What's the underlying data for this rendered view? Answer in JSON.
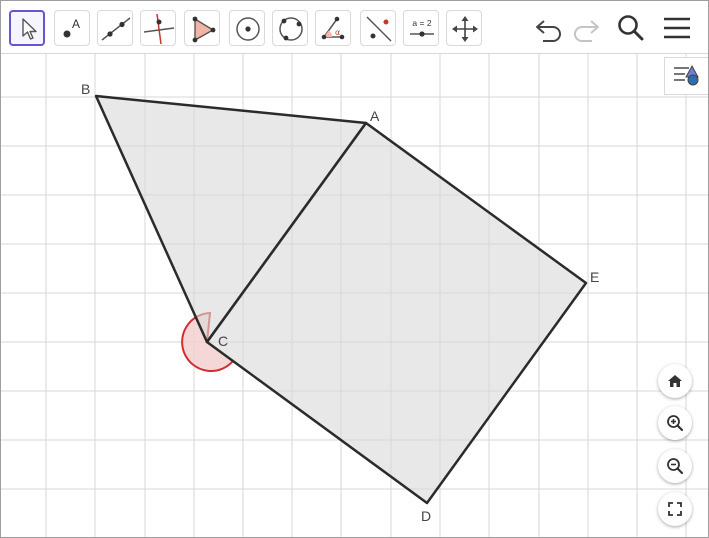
{
  "toolbar": {
    "tools": [
      {
        "name": "move-tool",
        "selected": true
      },
      {
        "name": "point-tool",
        "glyph": "A"
      },
      {
        "name": "line-tool"
      },
      {
        "name": "perpendicular-line-tool"
      },
      {
        "name": "polygon-tool"
      },
      {
        "name": "circle-center-point-tool"
      },
      {
        "name": "circle-three-points-tool"
      },
      {
        "name": "angle-tool",
        "glyph": "α"
      },
      {
        "name": "reflect-tool"
      },
      {
        "name": "slider-tool",
        "glyph": "a = 2"
      },
      {
        "name": "move-graphics-view-tool"
      }
    ],
    "actions": [
      "undo-icon",
      "redo-icon",
      "search-icon",
      "menu-icon"
    ]
  },
  "geometry": {
    "points": [
      {
        "label": "A"
      },
      {
        "label": "B"
      },
      {
        "label": "C"
      },
      {
        "label": "D"
      },
      {
        "label": "E"
      }
    ],
    "colors": {
      "grid": "#d7d7d7",
      "polygon_fill": "#d9d9d9",
      "polygon_stroke": "#2b2b2b",
      "angle_fill": "#f3d0d0",
      "angle_stroke": "#d22e2e",
      "accent": "#6557d2"
    }
  },
  "zoom_controls": [
    "home-icon",
    "zoom-in-icon",
    "zoom-out-icon",
    "fullscreen-icon"
  ]
}
